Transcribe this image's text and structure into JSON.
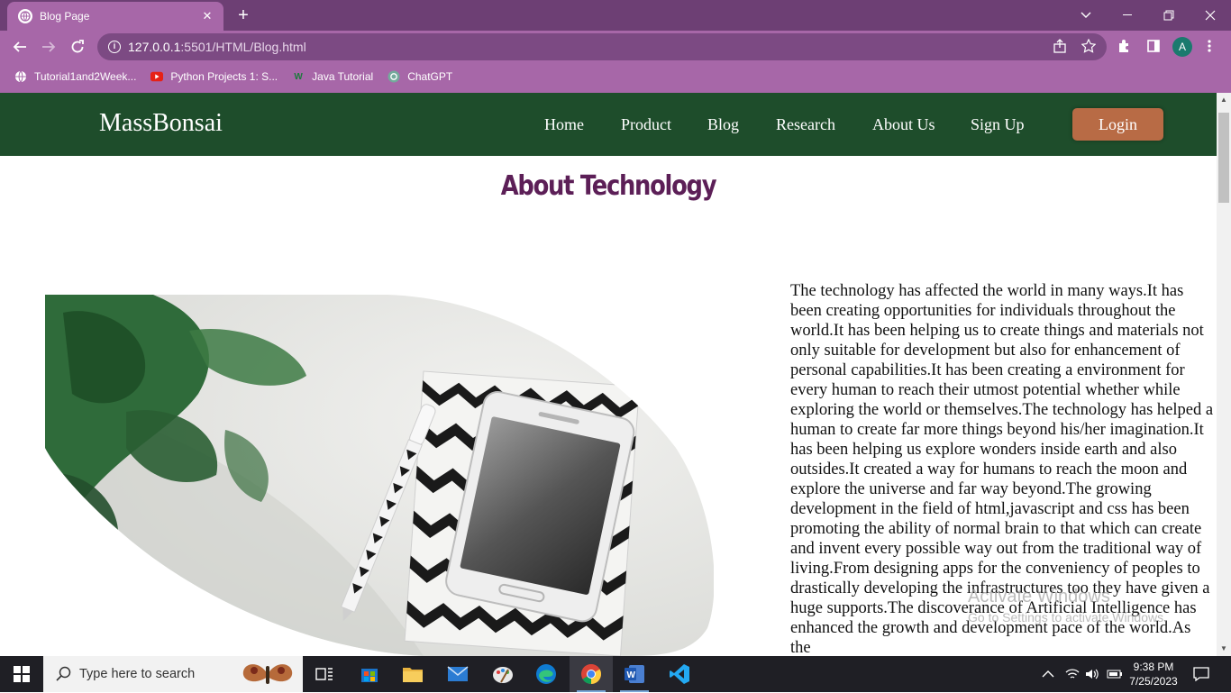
{
  "browser": {
    "tab_title": "Blog Page",
    "tab_close": "✕",
    "new_tab": "+",
    "url_host": "127.0.0.1",
    "url_path": ":5501/HTML/Blog.html",
    "profile_initial": "A",
    "bookmarks": [
      {
        "label": "Tutorial1and2Week..."
      },
      {
        "label": "Python Projects 1: S..."
      },
      {
        "label": "Java Tutorial"
      },
      {
        "label": "ChatGPT"
      }
    ]
  },
  "site": {
    "brand": "MassBonsai",
    "nav": [
      {
        "label": "Home"
      },
      {
        "label": "Product"
      },
      {
        "label": "Blog"
      },
      {
        "label": "Research"
      },
      {
        "label": "About Us"
      },
      {
        "label": "Sign Up"
      }
    ],
    "login": "Login",
    "heading": "About Technology",
    "article": "The technology has affected the world in many ways.It has been creating opportunities for individuals throughout the world.It has been helping us to create things and materials not only suitable for development but also for enhancement of personal capabilities.It has been creating a environment for every human to reach their utmost potential whether while exploring the world or themselves.The technology has helped a human to create far more things beyond his/her imagination.It has been helping us explore wonders inside earth and also outsides.It created a way for humans to reach the moon and explore the universe and far way beyond.The growing development in the field of html,javascript and css has been promoting the ability of normal brain to that which can create and invent every possible way out from the traditional way of living.From designing apps for the conveniency of peoples to drastically developing the infrastructures too they have given a huge supports.The discoverance of Artificial Intelligence has enhanced the growth and development pace of the world.As the"
  },
  "watermark": {
    "line1": "Activate Windows",
    "line2": "Go to Settings to activate Windows."
  },
  "taskbar": {
    "search_placeholder": "Type here to search",
    "time": "9:38 PM",
    "date": "7/25/2023"
  },
  "colors": {
    "chrome": "#a767a8",
    "tabstrip": "#6d3f74",
    "site_nav": "#1e4d2b",
    "login": "#b86b45",
    "heading": "#5c1f57"
  }
}
